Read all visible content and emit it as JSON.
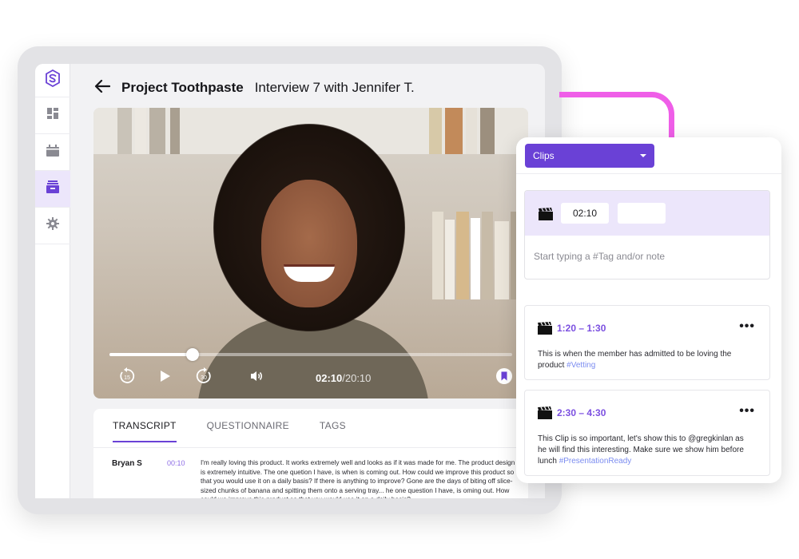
{
  "colors": {
    "accent": "#6a41d6",
    "accent_light": "#ece6fb",
    "connector_pink": "#ef5ee8",
    "tag_blue": "#7b8cf0"
  },
  "sidebar": {
    "items": [
      {
        "icon": "logo-icon"
      },
      {
        "icon": "dashboard-icon"
      },
      {
        "icon": "calendar-icon"
      },
      {
        "icon": "archive-icon",
        "active": true
      },
      {
        "icon": "gear-icon"
      }
    ]
  },
  "header": {
    "project_name": "Project Toothpaste",
    "interview_title": "Interview 7 with Jennifer T."
  },
  "player": {
    "current_time": "02:10",
    "total_time": "/20:10",
    "progress_fraction": 0.206
  },
  "transcript": {
    "tabs": [
      {
        "label": "TRANSCRIPT",
        "active": true
      },
      {
        "label": "QUESTIONNAIRE",
        "active": false
      },
      {
        "label": "TAGS",
        "active": false
      }
    ],
    "entry": {
      "speaker": "Bryan S",
      "timestamp": "00:10",
      "text": "I'm really loving this product. It works extremely well and looks as if it was made for me. The product design is extremely intuitive. The one quetion I have, is when is coming out. How could we improve this product so that you would use it on a daily basis? If there is anything to improve? Gone are the days of biting off slice-sized chunks of banana and spitting them onto a serving tray... he one question I have, is oming out. How could we improve this product so that you would use it on a daily basis?"
    }
  },
  "clips_panel": {
    "dropdown_label": "Clips",
    "new_clip": {
      "start_time": "02:10",
      "end_time": "",
      "note_placeholder": "Start typing a #Tag and/or note"
    },
    "clips": [
      {
        "range": "1:20 – 1:30",
        "more": "•••",
        "text": "This is when the member has admitted to be loving the product ",
        "tag": "#Vetting"
      },
      {
        "range": "2:30 – 4:30",
        "more": "•••",
        "text": "This Clip is so important, let's show this to @gregkinlan as he will find this interesting. Make sure we show him before lunch ",
        "tag": "#PresentationReady"
      }
    ]
  }
}
